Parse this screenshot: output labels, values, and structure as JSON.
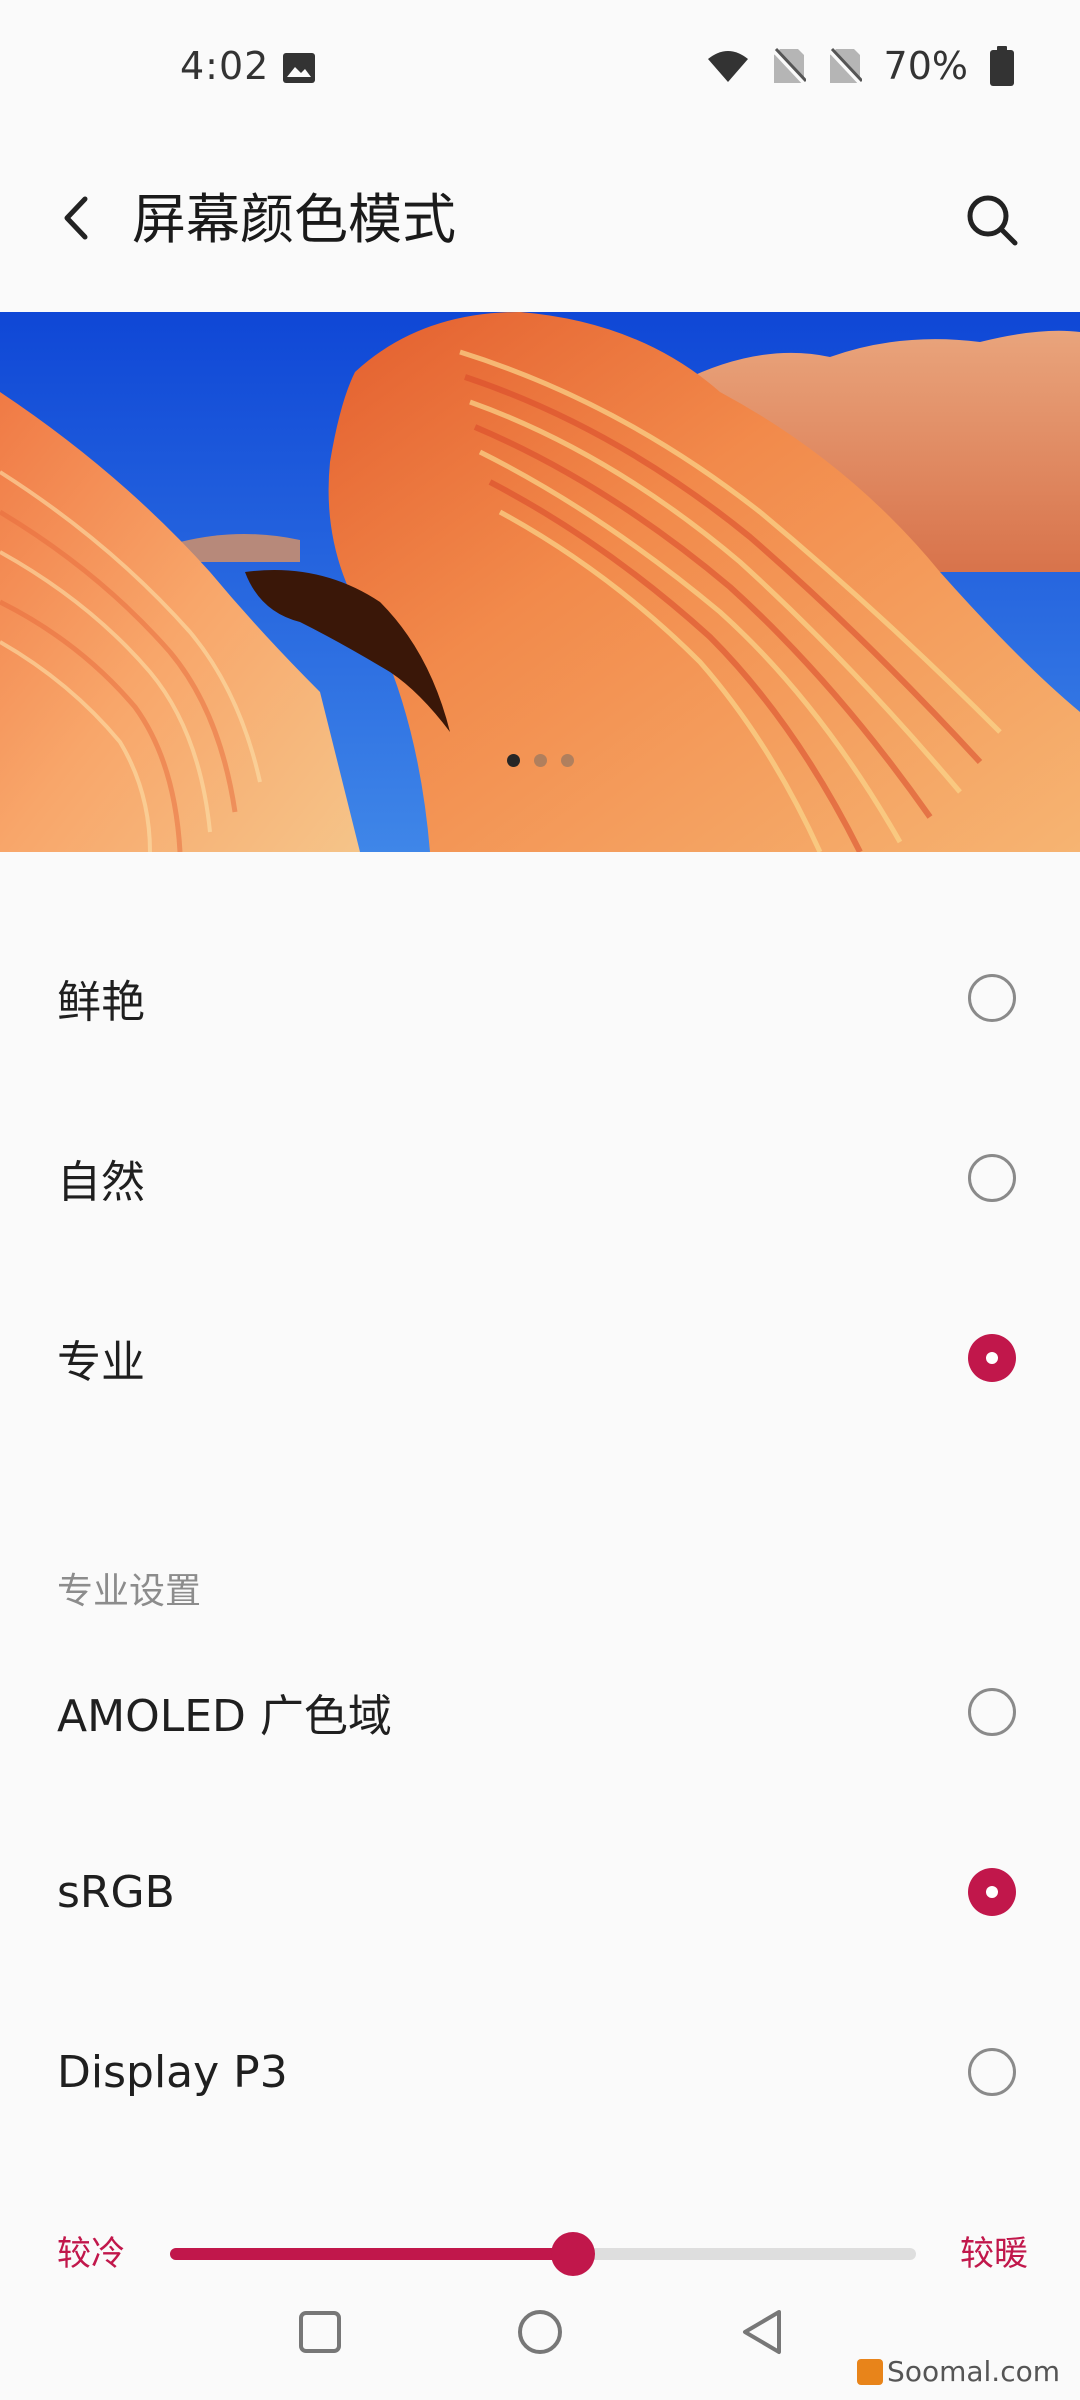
{
  "status_bar": {
    "time": "4:02",
    "battery": "70%",
    "icons": [
      "image-icon",
      "wifi-icon",
      "no-sim-icon",
      "no-sim-icon",
      "battery-icon"
    ]
  },
  "header": {
    "title": "屏幕颜色模式",
    "back_icon": "back-arrow-icon",
    "search_icon": "search-icon"
  },
  "preview": {
    "pages": 3,
    "active_page": 1
  },
  "color_modes": [
    {
      "label": "鲜艳",
      "selected": false
    },
    {
      "label": "自然",
      "selected": false
    },
    {
      "label": "专业",
      "selected": true
    }
  ],
  "pro_settings": {
    "header": "专业设置",
    "options": [
      {
        "label": "AMOLED 广色域",
        "selected": false
      },
      {
        "label": "sRGB",
        "selected": true
      },
      {
        "label": "Display P3",
        "selected": false
      }
    ]
  },
  "temperature_slider": {
    "min_label": "较冷",
    "max_label": "较暖",
    "value": 0.54
  },
  "watermark": "Soomal.com",
  "colors": {
    "accent": "#c1174b",
    "background": "#fafafa",
    "text": "#1f1f1f",
    "secondary_text": "#8c8c8c"
  }
}
